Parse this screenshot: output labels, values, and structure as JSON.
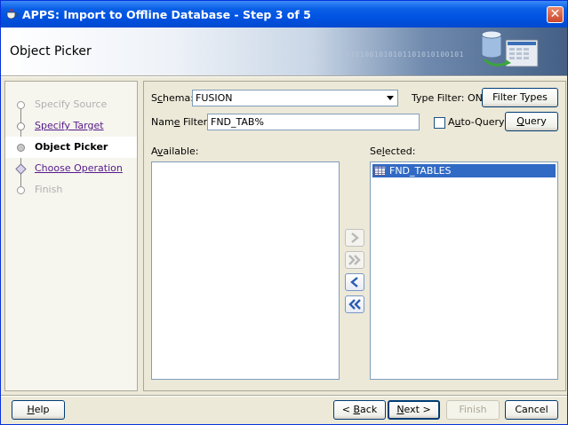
{
  "window": {
    "title": "APPS: Import to Offline Database - Step 3 of 5",
    "close_label": "✕"
  },
  "header": {
    "title": "Object Picker",
    "binary_decoration": "0101001010101101010100101"
  },
  "nav": {
    "items": [
      {
        "label": "Specify Source",
        "state": "disabled"
      },
      {
        "label": "Specify Target",
        "state": "link"
      },
      {
        "label": "Object Picker",
        "state": "active"
      },
      {
        "label": "Choose Operation",
        "state": "link"
      },
      {
        "label": "Finish",
        "state": "disabled"
      }
    ]
  },
  "form": {
    "schema_label_pre": "S",
    "schema_label_u": "c",
    "schema_label_post": "hema:",
    "schema_value": "FUSION",
    "type_filter_label": "Type Filter: ON",
    "filter_types_button": "Filter Types",
    "name_filter_label_pre": "Nam",
    "name_filter_label_u": "e",
    "name_filter_label_post": " Filter:",
    "name_filter_value": "FND_TAB%",
    "auto_query_label_pre": "A",
    "auto_query_label_u": "u",
    "auto_query_label_post": "to-Query",
    "auto_query_checked": false,
    "query_button_pre": "",
    "query_button_u": "Q",
    "query_button_post": "uery"
  },
  "available": {
    "label_pre": "A",
    "label_u": "v",
    "label_post": "ailable:",
    "items": []
  },
  "selected": {
    "label_pre": "Se",
    "label_u": "l",
    "label_post": "ected:",
    "items": [
      {
        "label": "FND_TABLES",
        "icon": "table-icon",
        "selected": true
      }
    ]
  },
  "footer": {
    "help_pre": "",
    "help_u": "H",
    "help_post": "elp",
    "back_pre": "< ",
    "back_u": "B",
    "back_post": "ack",
    "next_pre": "",
    "next_u": "N",
    "next_post": "ext >",
    "finish": "Finish",
    "cancel": "Cancel"
  },
  "colors": {
    "titlebar": "#0053e2",
    "selection": "#316ac5",
    "link": "#551a8b"
  }
}
